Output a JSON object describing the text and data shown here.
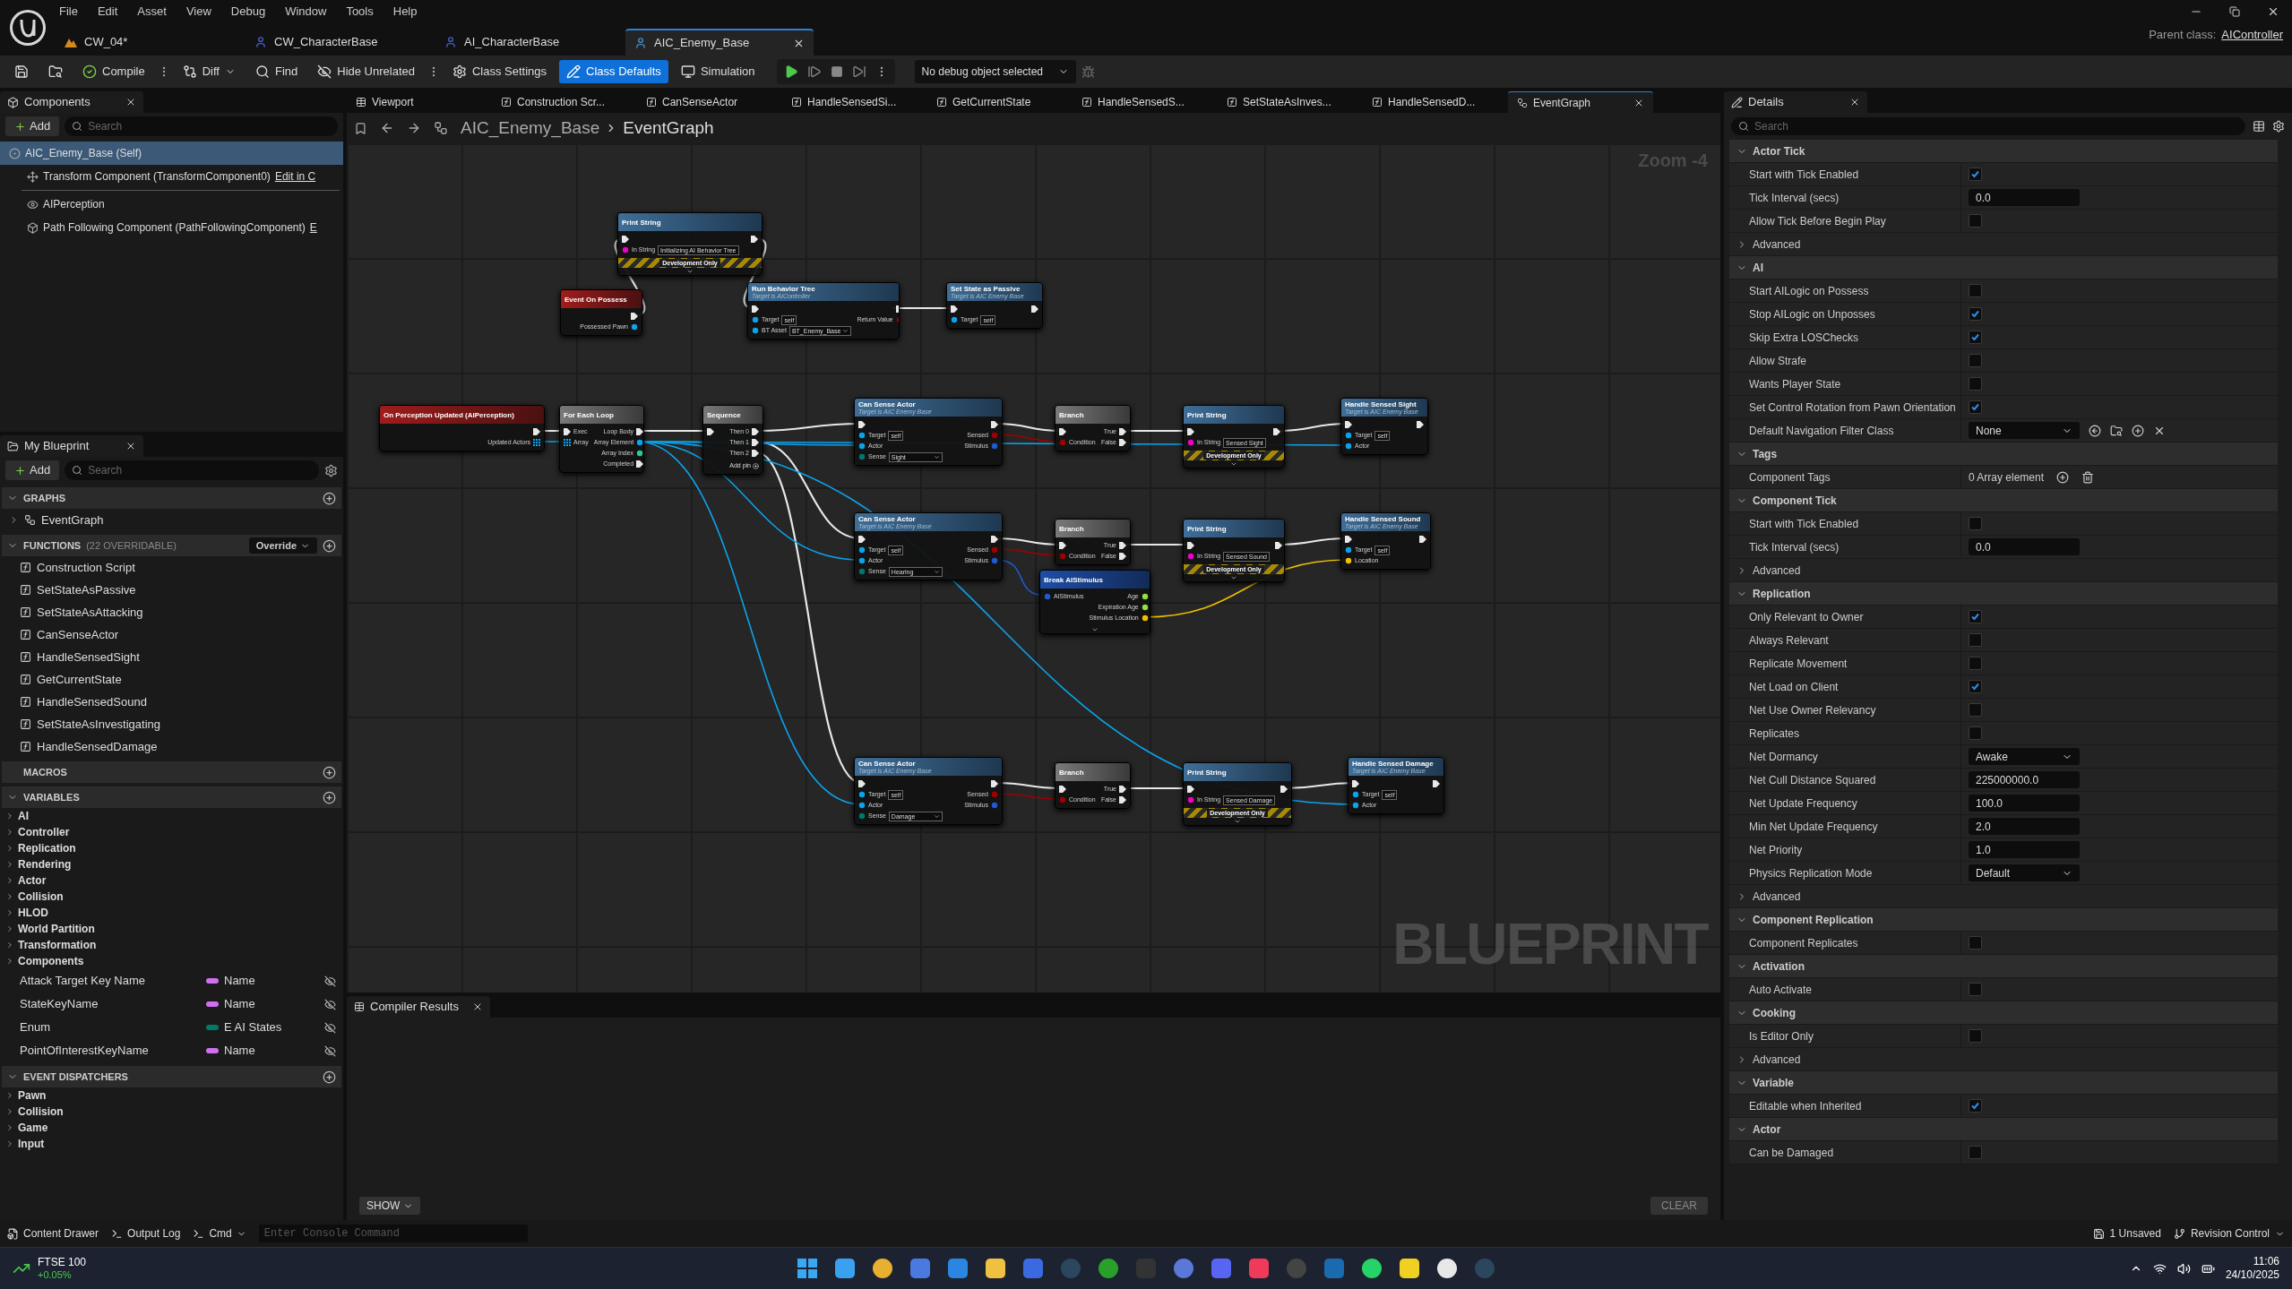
{
  "menu": [
    "File",
    "Edit",
    "Asset",
    "View",
    "Debug",
    "Window",
    "Tools",
    "Help"
  ],
  "document_tabs": [
    {
      "label": "CW_04*",
      "kind": "level",
      "selected": false
    },
    {
      "label": "CW_CharacterBase",
      "kind": "character",
      "selected": false
    },
    {
      "label": "AI_CharacterBase",
      "kind": "character",
      "selected": false
    },
    {
      "label": "AIC_Enemy_Base",
      "kind": "controller",
      "selected": true
    }
  ],
  "parent_class": {
    "label": "Parent class:",
    "value": "AIController"
  },
  "toolbar": [
    {
      "kind": "save"
    },
    {
      "kind": "browse"
    },
    {
      "kind": "compile",
      "label": "Compile",
      "menu": true
    },
    {
      "kind": "diff",
      "label": "Diff",
      "dropdown": true
    },
    {
      "kind": "find",
      "label": "Find"
    },
    {
      "kind": "hide",
      "label": "Hide Unrelated",
      "menu": true
    },
    {
      "kind": "settings",
      "label": "Class Settings"
    },
    {
      "kind": "defaults",
      "label": "Class Defaults",
      "selected": true
    },
    {
      "kind": "simulation",
      "label": "Simulation"
    }
  ],
  "debug_select": "No debug object selected",
  "components": {
    "title": "Components",
    "add": "Add",
    "search_placeholder": "Search",
    "items": [
      {
        "label": "AIC_Enemy_Base (Self)",
        "kind": "self",
        "selected": true,
        "children": [
          {
            "label": "Transform Component (TransformComponent0)",
            "kind": "transform",
            "selected": false,
            "link": "Edit in C"
          }
        ]
      },
      {
        "label": "AIPerception",
        "kind": "perception",
        "selected": false
      },
      {
        "label": "Path Following Component (PathFollowingComponent)",
        "kind": "component",
        "selected": false,
        "link": "E"
      }
    ]
  },
  "my_blueprint": {
    "title": "My Blueprint",
    "add": "Add",
    "search_placeholder": "Search",
    "sections": [
      {
        "title": "GRAPHS",
        "items": [
          {
            "label": "EventGraph",
            "kind": "graph"
          }
        ]
      },
      {
        "title": "FUNCTIONS",
        "note": "(22 OVERRIDABLE)",
        "button": "Override",
        "items": [
          {
            "label": "Construction Script",
            "kind": "construction"
          },
          {
            "label": "SetStateAsPassive",
            "kind": "function"
          },
          {
            "label": "SetStateAsAttacking",
            "kind": "function"
          },
          {
            "label": "CanSenseActor",
            "kind": "function"
          },
          {
            "label": "HandleSensedSight",
            "kind": "function"
          },
          {
            "label": "GetCurrentState",
            "kind": "function"
          },
          {
            "label": "HandleSensedSound",
            "kind": "function"
          },
          {
            "label": "SetStateAsInvestigating",
            "kind": "function"
          },
          {
            "label": "HandleSensedDamage",
            "kind": "function"
          }
        ]
      },
      {
        "title": "MACROS"
      },
      {
        "title": "VARIABLES",
        "categories": [
          "AI",
          "Controller",
          "Replication",
          "Rendering",
          "Actor",
          "Collision",
          "HLOD",
          "World Partition",
          "Transformation",
          "Components"
        ],
        "variables": [
          {
            "name": "Attack Target Key Name",
            "type": "Name",
            "color": "#d070f0"
          },
          {
            "name": "StateKeyName",
            "type": "Name",
            "color": "#d070f0"
          },
          {
            "name": "Enum",
            "type": "E AI States",
            "color": "#00796b"
          },
          {
            "name": "PointOfInterestKeyName",
            "type": "Name",
            "color": "#d070f0"
          }
        ]
      },
      {
        "title": "EVENT DISPATCHERS",
        "categories": [
          "Pawn",
          "Collision",
          "Game",
          "Input"
        ]
      }
    ]
  },
  "graph_tabs": [
    {
      "label": "Viewport",
      "kind": "viewport",
      "selected": false
    },
    {
      "label": "Construction Scr...",
      "kind": "function",
      "selected": false
    },
    {
      "label": "CanSenseActor",
      "kind": "function",
      "selected": false
    },
    {
      "label": "HandleSensedSi...",
      "kind": "function",
      "selected": false
    },
    {
      "label": "GetCurrentState",
      "kind": "function",
      "selected": false
    },
    {
      "label": "HandleSensedS...",
      "kind": "function",
      "selected": false
    },
    {
      "label": "SetStateAsInves...",
      "kind": "function",
      "selected": false
    },
    {
      "label": "HandleSensedD...",
      "kind": "function",
      "selected": false
    },
    {
      "label": "EventGraph",
      "kind": "graph",
      "selected": true
    }
  ],
  "breadcrumb": [
    "AIC_Enemy_Base",
    "EventGraph"
  ],
  "zoom": "Zoom -4",
  "graph_watermark": "BLUEPRINT",
  "nodes": [
    {
      "kind": "function",
      "title": "Print String",
      "inputs": [
        {
          "kind": "exec"
        },
        {
          "kind": "string",
          "label": "In String",
          "value": "Initializing AI Behavior Tree"
        }
      ],
      "outputs": [
        {
          "kind": "exec"
        }
      ],
      "footer": "Development Only",
      "expandable": true
    },
    {
      "kind": "event",
      "title": "Event On Possess",
      "outputs": [
        {
          "kind": "exec"
        },
        {
          "kind": "object",
          "label": "Possessed Pawn"
        }
      ]
    },
    {
      "kind": "function",
      "title": "Run Behavior Tree",
      "subtitle": "Target is AIController",
      "inputs": [
        {
          "kind": "exec"
        },
        {
          "kind": "object",
          "label": "Target",
          "value": "self"
        },
        {
          "kind": "asset",
          "label": "BT Asset",
          "value": "BT_Enemy_Base"
        }
      ],
      "outputs": [
        {
          "kind": "exec"
        },
        {
          "kind": "bool",
          "label": "Return Value"
        }
      ]
    },
    {
      "kind": "function",
      "title": "Set State as Passive",
      "subtitle": "Target is AIC Enemy Base",
      "inputs": [
        {
          "kind": "exec"
        },
        {
          "kind": "object",
          "label": "Target",
          "value": "self"
        }
      ],
      "outputs": [
        {
          "kind": "exec"
        }
      ]
    },
    {
      "kind": "event",
      "title": "On Perception Updated (AIPerception)",
      "outputs": [
        {
          "kind": "exec"
        },
        {
          "kind": "array",
          "label": "Updated Actors"
        }
      ]
    },
    {
      "kind": "macro",
      "title": "For Each Loop",
      "inputs": [
        {
          "kind": "exec",
          "label": "Exec"
        },
        {
          "kind": "array",
          "label": "Array"
        }
      ],
      "outputs": [
        {
          "kind": "exec",
          "label": "Loop Body"
        },
        {
          "kind": "object",
          "label": "Array Element"
        },
        {
          "kind": "int",
          "label": "Array Index"
        },
        {
          "kind": "exec",
          "label": "Completed"
        }
      ]
    },
    {
      "kind": "macro",
      "title": "Sequence",
      "inputs": [
        {
          "kind": "exec"
        }
      ],
      "outputs": [
        {
          "kind": "exec",
          "label": "Then 0"
        },
        {
          "kind": "exec",
          "label": "Then 1"
        },
        {
          "kind": "exec",
          "label": "Then 2"
        }
      ],
      "add_pin": "Add pin"
    },
    {
      "kind": "function",
      "title": "Can Sense Actor",
      "subtitle": "Target is AIC Enemy Base",
      "inputs": [
        {
          "kind": "exec"
        },
        {
          "kind": "object",
          "label": "Target",
          "value": "self"
        },
        {
          "kind": "object",
          "label": "Actor"
        },
        {
          "kind": "enum",
          "label": "Sense",
          "value": "Sight"
        }
      ],
      "outputs": [
        {
          "kind": "exec"
        },
        {
          "kind": "bool",
          "label": "Sensed"
        },
        {
          "kind": "struct",
          "label": "Stimulus"
        }
      ]
    },
    {
      "kind": "macro",
      "title": "Branch",
      "inputs": [
        {
          "kind": "exec"
        },
        {
          "kind": "bool",
          "label": "Condition"
        }
      ],
      "outputs": [
        {
          "kind": "exec",
          "label": "True"
        },
        {
          "kind": "exec",
          "label": "False"
        }
      ]
    },
    {
      "kind": "function",
      "title": "Print String",
      "inputs": [
        {
          "kind": "exec"
        },
        {
          "kind": "string",
          "label": "In String",
          "value": "Sensed Sight"
        }
      ],
      "outputs": [
        {
          "kind": "exec"
        }
      ],
      "footer": "Development Only",
      "expandable": true
    },
    {
      "kind": "event_call",
      "title": "Handle Sensed Sight",
      "subtitle": "Target is AIC Enemy Base",
      "inputs": [
        {
          "kind": "exec"
        },
        {
          "kind": "object",
          "label": "Target",
          "value": "self"
        },
        {
          "kind": "object",
          "label": "Actor"
        }
      ],
      "outputs": [
        {
          "kind": "exec"
        }
      ]
    },
    {
      "kind": "function",
      "title": "Can Sense Actor",
      "subtitle": "Target is AIC Enemy Base",
      "inputs": [
        {
          "kind": "exec"
        },
        {
          "kind": "object",
          "label": "Target",
          "value": "self"
        },
        {
          "kind": "object",
          "label": "Actor"
        },
        {
          "kind": "enum",
          "label": "Sense",
          "value": "Hearing"
        }
      ],
      "outputs": [
        {
          "kind": "exec"
        },
        {
          "kind": "bool",
          "label": "Sensed"
        },
        {
          "kind": "struct",
          "label": "Stimulus"
        }
      ]
    },
    {
      "kind": "macro",
      "title": "Branch",
      "inputs": [
        {
          "kind": "exec"
        },
        {
          "kind": "bool",
          "label": "Condition"
        }
      ],
      "outputs": [
        {
          "kind": "exec",
          "label": "True"
        },
        {
          "kind": "exec",
          "label": "False"
        }
      ]
    },
    {
      "kind": "function",
      "title": "Print String",
      "inputs": [
        {
          "kind": "exec"
        },
        {
          "kind": "string",
          "label": "In String",
          "value": "Sensed Sound"
        }
      ],
      "outputs": [
        {
          "kind": "exec"
        }
      ],
      "footer": "Development Only",
      "expandable": true
    },
    {
      "kind": "event_call",
      "title": "Handle Sensed Sound",
      "subtitle": "Target is AIC Enemy Base",
      "inputs": [
        {
          "kind": "exec"
        },
        {
          "kind": "object",
          "label": "Target",
          "value": "self"
        },
        {
          "kind": "vector",
          "label": "Location"
        }
      ],
      "outputs": [
        {
          "kind": "exec"
        }
      ]
    },
    {
      "kind": "pure",
      "title": "Break AIStimulus",
      "inputs": [
        {
          "kind": "struct",
          "label": "AIStimulus"
        }
      ],
      "outputs": [
        {
          "kind": "float",
          "label": "Age"
        },
        {
          "kind": "float",
          "label": "Expiration Age"
        },
        {
          "kind": "vector",
          "label": "Stimulus Location"
        }
      ],
      "expandable": true
    },
    {
      "kind": "function",
      "title": "Can Sense Actor",
      "subtitle": "Target is AIC Enemy Base",
      "inputs": [
        {
          "kind": "exec"
        },
        {
          "kind": "object",
          "label": "Target",
          "value": "self"
        },
        {
          "kind": "object",
          "label": "Actor"
        },
        {
          "kind": "enum",
          "label": "Sense",
          "value": "Damage"
        }
      ],
      "outputs": [
        {
          "kind": "exec"
        },
        {
          "kind": "bool",
          "label": "Sensed"
        },
        {
          "kind": "struct",
          "label": "Stimulus"
        }
      ]
    },
    {
      "kind": "macro",
      "title": "Branch",
      "inputs": [
        {
          "kind": "exec"
        },
        {
          "kind": "bool",
          "label": "Condition"
        }
      ],
      "outputs": [
        {
          "kind": "exec",
          "label": "True"
        },
        {
          "kind": "exec",
          "label": "False"
        }
      ]
    },
    {
      "kind": "function",
      "title": "Print String",
      "inputs": [
        {
          "kind": "exec"
        },
        {
          "kind": "string",
          "label": "In String",
          "value": "Sensed Damage"
        }
      ],
      "outputs": [
        {
          "kind": "exec"
        }
      ],
      "footer": "Development Only",
      "expandable": true
    },
    {
      "kind": "event_call",
      "title": "Handle Sensed Damage",
      "subtitle": "Target is AIC Enemy Base",
      "inputs": [
        {
          "kind": "exec"
        },
        {
          "kind": "object",
          "label": "Target",
          "value": "self"
        },
        {
          "kind": "object",
          "label": "Actor"
        }
      ],
      "outputs": [
        {
          "kind": "exec"
        }
      ]
    }
  ],
  "compiler_results": {
    "title": "Compiler Results",
    "show": "SHOW",
    "clear": "CLEAR"
  },
  "details": {
    "title": "Details",
    "search_placeholder": "Search",
    "sections": [
      {
        "title": "Actor Tick",
        "rows": [
          {
            "kind": "checkbox",
            "label": "Start with Tick Enabled",
            "checked": true
          },
          {
            "kind": "number",
            "label": "Tick Interval (secs)",
            "value": "0.0"
          },
          {
            "kind": "checkbox",
            "label": "Allow Tick Before Begin Play",
            "checked": false
          },
          {
            "kind": "advanced",
            "label": "Advanced"
          }
        ]
      },
      {
        "title": "AI",
        "rows": [
          {
            "kind": "checkbox",
            "label": "Start AILogic on Possess",
            "checked": false
          },
          {
            "kind": "checkbox",
            "label": "Stop AILogic on Unposses",
            "checked": true
          },
          {
            "kind": "checkbox",
            "label": "Skip Extra LOSChecks",
            "checked": true
          },
          {
            "kind": "checkbox",
            "label": "Allow Strafe",
            "checked": false
          },
          {
            "kind": "checkbox",
            "label": "Wants Player State",
            "checked": false
          },
          {
            "kind": "checkbox",
            "label": "Set Control Rotation from Pawn Orientation",
            "checked": true
          },
          {
            "kind": "class",
            "label": "Default Navigation Filter Class",
            "value": "None"
          }
        ]
      },
      {
        "title": "Tags",
        "rows": [
          {
            "kind": "array",
            "label": "Component Tags",
            "value": "0 Array element"
          }
        ]
      },
      {
        "title": "Component Tick",
        "rows": [
          {
            "kind": "checkbox",
            "label": "Start with Tick Enabled",
            "checked": false
          },
          {
            "kind": "number",
            "label": "Tick Interval (secs)",
            "value": "0.0"
          },
          {
            "kind": "advanced",
            "label": "Advanced"
          }
        ]
      },
      {
        "title": "Replication",
        "rows": [
          {
            "kind": "checkbox",
            "label": "Only Relevant to Owner",
            "checked": true
          },
          {
            "kind": "checkbox",
            "label": "Always Relevant",
            "checked": false
          },
          {
            "kind": "checkbox",
            "label": "Replicate Movement",
            "checked": false
          },
          {
            "kind": "checkbox",
            "label": "Net Load on Client",
            "checked": true
          },
          {
            "kind": "checkbox",
            "label": "Net Use Owner Relevancy",
            "checked": false
          },
          {
            "kind": "checkbox",
            "label": "Replicates",
            "checked": false
          },
          {
            "kind": "dropdown",
            "label": "Net Dormancy",
            "value": "Awake"
          },
          {
            "kind": "number",
            "label": "Net Cull Distance Squared",
            "value": "225000000.0"
          },
          {
            "kind": "number",
            "label": "Net Update Frequency",
            "value": "100.0"
          },
          {
            "kind": "number",
            "label": "Min Net Update Frequency",
            "value": "2.0"
          },
          {
            "kind": "number",
            "label": "Net Priority",
            "value": "1.0"
          },
          {
            "kind": "dropdown",
            "label": "Physics Replication Mode",
            "value": "Default"
          },
          {
            "kind": "advanced",
            "label": "Advanced"
          }
        ]
      },
      {
        "title": "Component Replication",
        "rows": [
          {
            "kind": "checkbox",
            "label": "Component Replicates",
            "checked": false
          }
        ]
      },
      {
        "title": "Activation",
        "rows": [
          {
            "kind": "checkbox",
            "label": "Auto Activate",
            "checked": false
          }
        ]
      },
      {
        "title": "Cooking",
        "rows": [
          {
            "kind": "checkbox",
            "label": "Is Editor Only",
            "checked": false
          },
          {
            "kind": "advanced",
            "label": "Advanced"
          }
        ]
      },
      {
        "title": "Variable",
        "rows": [
          {
            "kind": "checkbox",
            "label": "Editable when Inherited",
            "checked": true
          }
        ]
      },
      {
        "title": "Actor",
        "rows": [
          {
            "kind": "checkbox",
            "label": "Can be Damaged",
            "checked": false
          }
        ]
      }
    ]
  },
  "status_bar": {
    "content_drawer": "Content Drawer",
    "output_log": "Output Log",
    "cmd": "Cmd",
    "console_placeholder": "Enter Console Command",
    "unsaved": "1 Unsaved",
    "revision_control": "Revision Control"
  },
  "taskbar": {
    "widget_title": "FTSE 100",
    "widget_value": "+0.05%",
    "time": "11:06",
    "date": "24/10/2025"
  }
}
